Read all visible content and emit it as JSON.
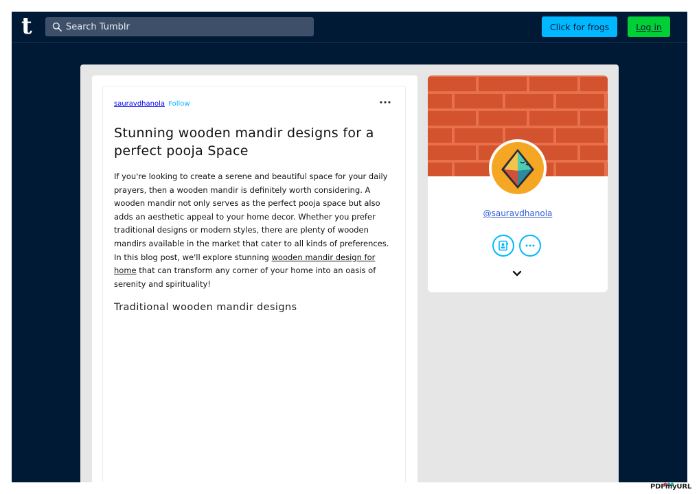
{
  "topbar": {
    "logo": "t",
    "search_placeholder": "Search Tumblr",
    "frogs_button": "Click for frogs",
    "login_button": "Log in"
  },
  "post": {
    "author": "sauravdhanola",
    "follow": "Follow",
    "title": "Stunning wooden mandir designs for a perfect pooja Space",
    "body_before_link": "If you're looking to create a serene and beautiful space for your daily prayers, then a wooden mandir is definitely worth considering. A wooden mandir not only serves as the perfect pooja space but also adds an aesthetic appeal to your home decor. Whether you prefer traditional designs or modern styles, there are plenty of wooden mandirs available in the market that cater to all kinds of preferences. In this blog post, we'll explore stunning ",
    "body_link": "wooden mandir design for home",
    "body_after_link": " that can transform any corner of your home into an oasis of serenity and spirituality!",
    "subheading": "Traditional wooden mandir designs"
  },
  "blog_card": {
    "username": "@sauravdhanola",
    "banner_color": "#d4532f",
    "accent_color": "#00b8ff"
  },
  "footer": {
    "watermark": "PDFmyURL"
  },
  "colors": {
    "background": "#001935",
    "frogs_button": "#00b8ff",
    "login_button": "#00cf35"
  }
}
